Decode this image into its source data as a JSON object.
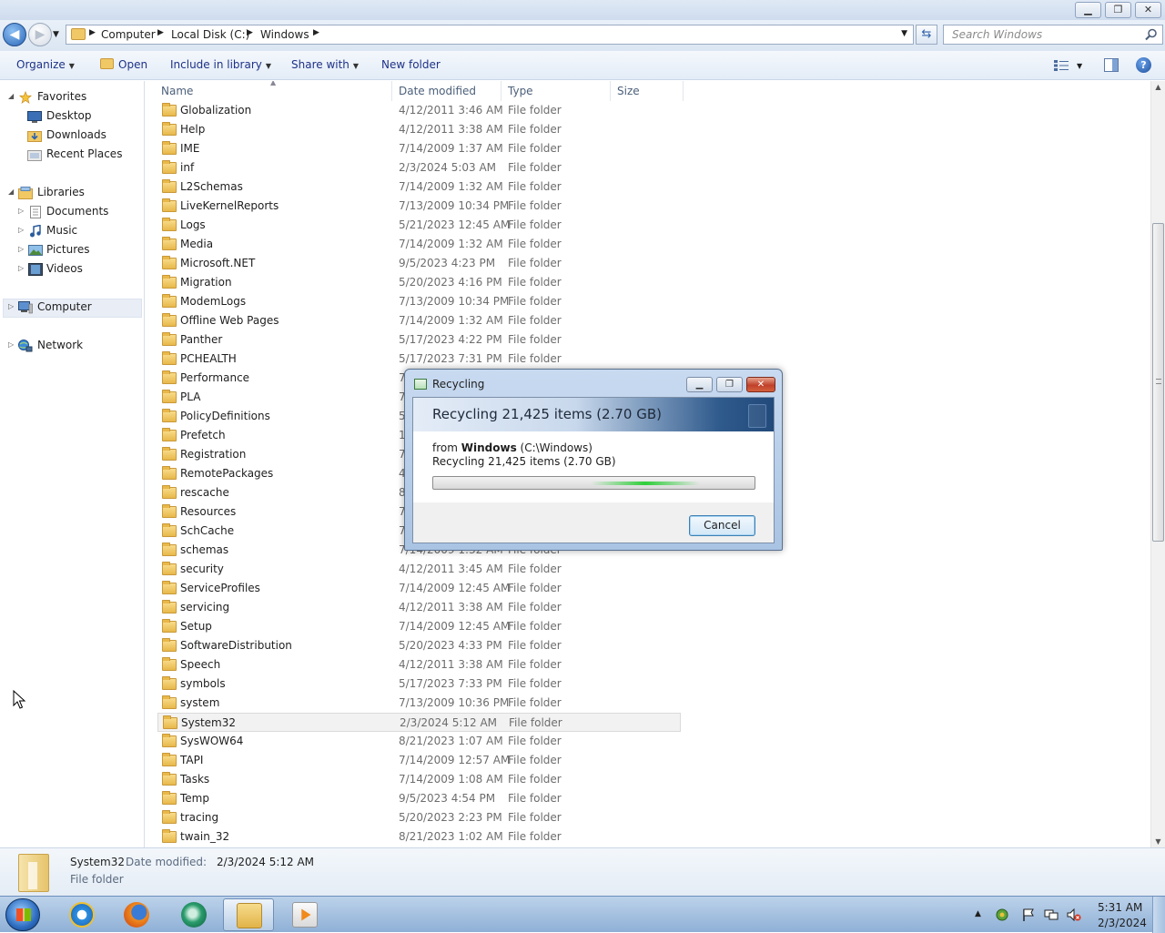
{
  "window": {
    "minimize_glyph": "▁",
    "maximize_glyph": "❐",
    "close_glyph": "✕"
  },
  "address": {
    "crumbs": [
      "Computer",
      "Local Disk (C:)",
      "Windows"
    ],
    "search_placeholder": "Search Windows"
  },
  "toolbar": {
    "organize": "Organize",
    "open": "Open",
    "include_in_library": "Include in library",
    "share_with": "Share with",
    "new_folder": "New folder"
  },
  "navigation": {
    "favorites": "Favorites",
    "desktop": "Desktop",
    "downloads": "Downloads",
    "recent_places": "Recent Places",
    "libraries": "Libraries",
    "documents": "Documents",
    "music": "Music",
    "pictures": "Pictures",
    "videos": "Videos",
    "computer": "Computer",
    "network": "Network"
  },
  "columns": {
    "name": "Name",
    "date_modified": "Date modified",
    "type": "Type",
    "size": "Size"
  },
  "files": [
    {
      "name": "Globalization",
      "date": "4/12/2011 3:46 AM",
      "type": "File folder"
    },
    {
      "name": "Help",
      "date": "4/12/2011 3:38 AM",
      "type": "File folder"
    },
    {
      "name": "IME",
      "date": "7/14/2009 1:37 AM",
      "type": "File folder"
    },
    {
      "name": "inf",
      "date": "2/3/2024 5:03 AM",
      "type": "File folder"
    },
    {
      "name": "L2Schemas",
      "date": "7/14/2009 1:32 AM",
      "type": "File folder"
    },
    {
      "name": "LiveKernelReports",
      "date": "7/13/2009 10:34 PM",
      "type": "File folder"
    },
    {
      "name": "Logs",
      "date": "5/21/2023 12:45 AM",
      "type": "File folder"
    },
    {
      "name": "Media",
      "date": "7/14/2009 1:32 AM",
      "type": "File folder"
    },
    {
      "name": "Microsoft.NET",
      "date": "9/5/2023 4:23 PM",
      "type": "File folder"
    },
    {
      "name": "Migration",
      "date": "5/20/2023 4:16 PM",
      "type": "File folder"
    },
    {
      "name": "ModemLogs",
      "date": "7/13/2009 10:34 PM",
      "type": "File folder"
    },
    {
      "name": "Offline Web Pages",
      "date": "7/14/2009 1:32 AM",
      "type": "File folder"
    },
    {
      "name": "Panther",
      "date": "5/17/2023 4:22 PM",
      "type": "File folder"
    },
    {
      "name": "PCHEALTH",
      "date": "5/17/2023 7:31 PM",
      "type": "File folder"
    },
    {
      "name": "Performance",
      "date": "7",
      "type": ""
    },
    {
      "name": "PLA",
      "date": "7",
      "type": ""
    },
    {
      "name": "PolicyDefinitions",
      "date": "5",
      "type": ""
    },
    {
      "name": "Prefetch",
      "date": "1",
      "type": ""
    },
    {
      "name": "Registration",
      "date": "7",
      "type": ""
    },
    {
      "name": "RemotePackages",
      "date": "4",
      "type": ""
    },
    {
      "name": "rescache",
      "date": "8",
      "type": ""
    },
    {
      "name": "Resources",
      "date": "7",
      "type": ""
    },
    {
      "name": "SchCache",
      "date": "7",
      "type": ""
    },
    {
      "name": "schemas",
      "date": "7/14/2009 1:32 AM",
      "type": "File folder"
    },
    {
      "name": "security",
      "date": "4/12/2011 3:45 AM",
      "type": "File folder"
    },
    {
      "name": "ServiceProfiles",
      "date": "7/14/2009 12:45 AM",
      "type": "File folder"
    },
    {
      "name": "servicing",
      "date": "4/12/2011 3:38 AM",
      "type": "File folder"
    },
    {
      "name": "Setup",
      "date": "7/14/2009 12:45 AM",
      "type": "File folder"
    },
    {
      "name": "SoftwareDistribution",
      "date": "5/20/2023 4:33 PM",
      "type": "File folder"
    },
    {
      "name": "Speech",
      "date": "4/12/2011 3:38 AM",
      "type": "File folder"
    },
    {
      "name": "symbols",
      "date": "5/17/2023 7:33 PM",
      "type": "File folder"
    },
    {
      "name": "system",
      "date": "7/13/2009 10:36 PM",
      "type": "File folder"
    },
    {
      "name": "System32",
      "date": "2/3/2024 5:12 AM",
      "type": "File folder",
      "selected": true
    },
    {
      "name": "SysWOW64",
      "date": "8/21/2023 1:07 AM",
      "type": "File folder"
    },
    {
      "name": "TAPI",
      "date": "7/14/2009 12:57 AM",
      "type": "File folder"
    },
    {
      "name": "Tasks",
      "date": "7/14/2009 1:08 AM",
      "type": "File folder"
    },
    {
      "name": "Temp",
      "date": "9/5/2023 4:54 PM",
      "type": "File folder"
    },
    {
      "name": "tracing",
      "date": "5/20/2023 2:23 PM",
      "type": "File folder"
    },
    {
      "name": "twain_32",
      "date": "8/21/2023 1:02 AM",
      "type": "File folder"
    }
  ],
  "details": {
    "name": "System32",
    "date_label": "Date modified:",
    "date": "2/3/2024 5:12 AM",
    "type": "File folder"
  },
  "dialog": {
    "title": "Recycling",
    "header": "Recycling 21,425 items (2.70 GB)",
    "from_prefix": "from ",
    "from_folder": "Windows",
    "from_path": " (C:\\Windows)",
    "status": "Recycling 21,425 items (2.70 GB)",
    "cancel": "Cancel",
    "progress_glow_center": 0.66,
    "progress_glow_width": 0.34
  },
  "taskbar": {
    "time": "5:31 AM",
    "date": "2/3/2024"
  },
  "colors": {
    "accent": "#1e3287",
    "progress_glow": "#2fcf3a",
    "close_red": "#c0412a"
  }
}
